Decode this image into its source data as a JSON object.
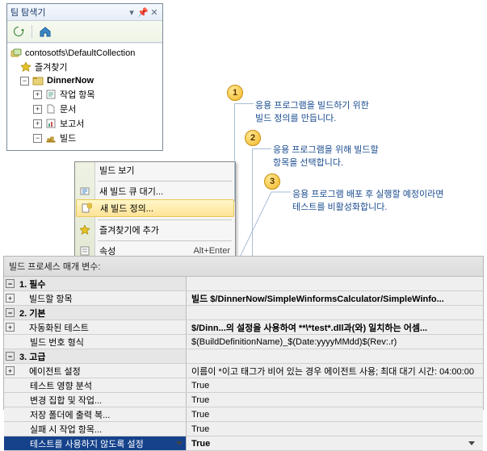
{
  "teamExplorer": {
    "title": "팀 탐색기",
    "toolbar": {
      "refresh": "refresh",
      "home": "home"
    },
    "root": "contosotfs\\DefaultCollection",
    "nodes": {
      "favorites": "즐겨찾기",
      "project": "DinnerNow",
      "workitems": "작업 항목",
      "documents": "문서",
      "reports": "보고서",
      "builds": "빌드"
    }
  },
  "contextMenu": {
    "items": {
      "viewBuilds": "빌드 보기",
      "newQueue": "새 빌드 큐 대기...",
      "newDef": "새 빌드 정의...",
      "addFav": "즐겨찾기에 추가",
      "properties": "속성"
    },
    "hotkey": "Alt+Enter"
  },
  "callouts": {
    "c1": {
      "n": "1",
      "l1": "응용 프로그램을 빌드하기 위한",
      "l2": "빌드 정의를 만듭니다."
    },
    "c2": {
      "n": "2",
      "l1": "응용 프로그램을 위해 빌드할",
      "l2": "항목을 선택합니다."
    },
    "c3": {
      "n": "3",
      "l1": "응용 프로그램 배포 후 실행할 예정이라면",
      "l2": "테스트를 비활성화합니다."
    }
  },
  "props": {
    "title": "빌드 프로세스 매개 변수:",
    "rows": {
      "cat1": {
        "name": "1. 필수"
      },
      "r_item": {
        "name": "빌드할 항목",
        "val": "빌드 $/DinnerNow/SimpleWinformsCalculator/SimpleWinfo..."
      },
      "cat2": {
        "name": "2. 기본"
      },
      "r_test": {
        "name": "자동화된 테스트",
        "val": "$/Dinn...의 설정을 사용하여 **\\*test*.dll과(와) 일치하는 어셈..."
      },
      "r_fmt": {
        "name": "빌드 번호 형식",
        "val": "$(BuildDefinitionName)_$(Date:yyyyMMdd)$(Rev:.r)"
      },
      "cat3": {
        "name": "3. 고급"
      },
      "r_agent": {
        "name": "에이전트 설정",
        "val": "이름이 *이고 태그가 비어 있는 경우 에이전트 사용; 최대 대기 시간: 04:00:00"
      },
      "r_impact": {
        "name": "테스트 영향 분석",
        "val": "True"
      },
      "r_changeset": {
        "name": "변경 집합 및 작업...",
        "val": "True"
      },
      "r_drop": {
        "name": "저장 폴더에 출력 복...",
        "val": "True"
      },
      "r_fail": {
        "name": "실패 시 작업 항목...",
        "val": "True"
      },
      "r_disable": {
        "name": "테스트를 사용하지 않도록 설정",
        "val": "True"
      }
    }
  }
}
